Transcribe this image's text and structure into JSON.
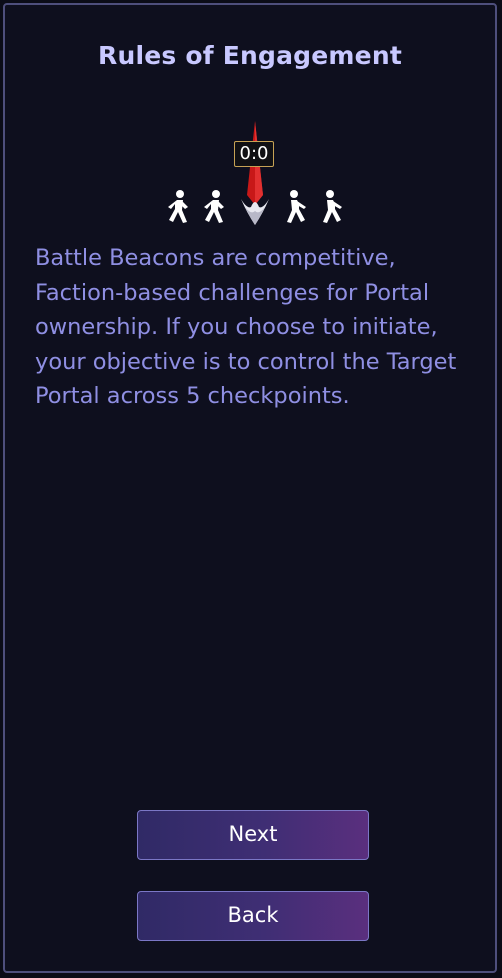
{
  "dialog": {
    "title": "Rules of Engagement",
    "timer": "0:0",
    "description": "Battle Beacons are competitive, Faction-based challenges for Portal ownership. If you choose to initiate, your objective is to control the Target Portal across 5 checkpoints.",
    "icons": [
      "walking-person-icon",
      "walking-person-icon",
      "beacon-icon",
      "walking-person-icon",
      "walking-person-icon"
    ]
  },
  "buttons": {
    "next": "Next",
    "back": "Back"
  },
  "colors": {
    "background": "#0e0f1e",
    "border": "#4e4f7c",
    "title": "#c8c8ff",
    "text": "#8f8fe3",
    "beacon": "#d01a1a",
    "timer_border": "#c6a255",
    "button_gradient_start": "#302a66",
    "button_gradient_end": "#5a2f7e"
  }
}
